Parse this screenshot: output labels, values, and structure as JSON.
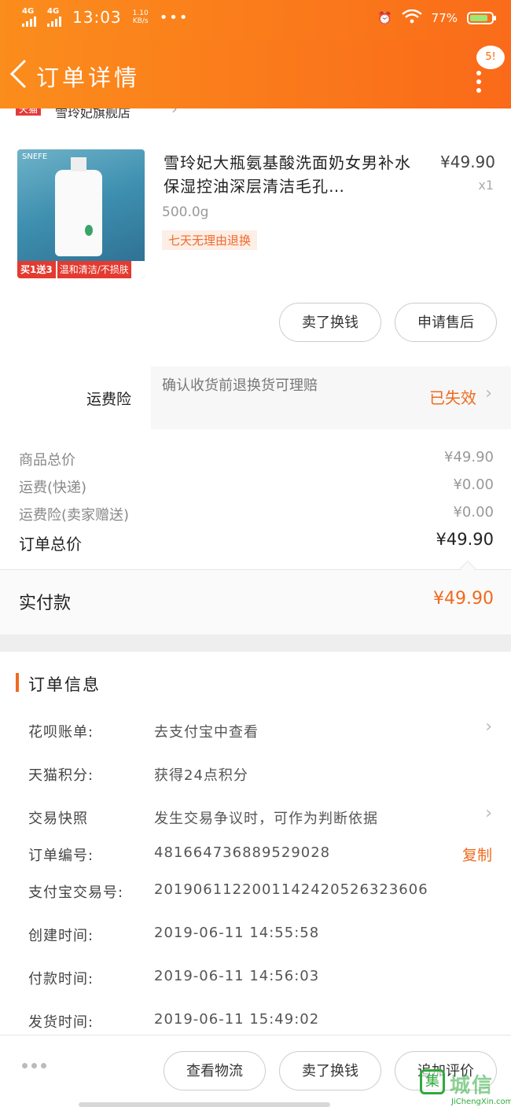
{
  "status_bar": {
    "net1": "4G",
    "net2": "4G",
    "time": "13:03",
    "speed": "1.10",
    "speed_unit": "KB/s",
    "more": "•••",
    "battery": "77%"
  },
  "nav": {
    "back": "<",
    "title": "订单详情",
    "msg_count": "5!"
  },
  "shop": {
    "tag": "天猫",
    "name": "雪玲妃旗舰店"
  },
  "product": {
    "image_brand": "SNEFE",
    "image_promo": "买1送3",
    "image_tagline": "温和清洁/不损肤",
    "title": "雪玲妃大瓶氨基酸洗面奶女男补水保湿控油深层清洁毛孔…",
    "price": "¥49.90",
    "qty": "x1",
    "spec": "500.0g",
    "badge": "七天无理由退换"
  },
  "item_actions": {
    "sell_swap": "卖了换钱",
    "after_sale": "申请售后"
  },
  "insurance": {
    "label": "运费险",
    "text": "确认收货前退换货可理赔",
    "status": "已失效"
  },
  "fees": [
    {
      "label": "商品总价",
      "value": "¥49.90"
    },
    {
      "label": "运费(快递)",
      "value": "¥0.00"
    },
    {
      "label": "运费险(卖家赠送)",
      "value": "¥0.00"
    }
  ],
  "order_total": {
    "label": "订单总价",
    "value": "¥49.90"
  },
  "paid": {
    "label": "实付款",
    "value": "¥49.90"
  },
  "order_info": {
    "title": "订单信息",
    "rows": [
      {
        "label": "花呗账单:",
        "value": "去支付宝中查看"
      },
      {
        "label": "天猫积分:",
        "value": "获得24点积分"
      },
      {
        "label": "交易快照",
        "value": "发生交易争议时，可作为判断依据"
      },
      {
        "label": "订单编号:",
        "value": "481664736889529028"
      },
      {
        "label": "支付宝交易号:",
        "value": "2019061122001142420526323606"
      },
      {
        "label": "创建时间:",
        "value": "2019-06-11 14:55:58"
      },
      {
        "label": "付款时间:",
        "value": "2019-06-11 14:56:03"
      },
      {
        "label": "发货时间:",
        "value": "2019-06-11 15:49:02"
      }
    ],
    "copy_label": "复制"
  },
  "bottom_actions": {
    "logistics": "查看物流",
    "sell_swap": "卖了换钱",
    "review": "追加评价"
  },
  "watermark": {
    "cn": "城信",
    "en": "JiChengXin.com"
  },
  "colors": {
    "accent": "#f06a1e",
    "header_start": "#fb8d1c",
    "header_end": "#fa6a1a"
  }
}
